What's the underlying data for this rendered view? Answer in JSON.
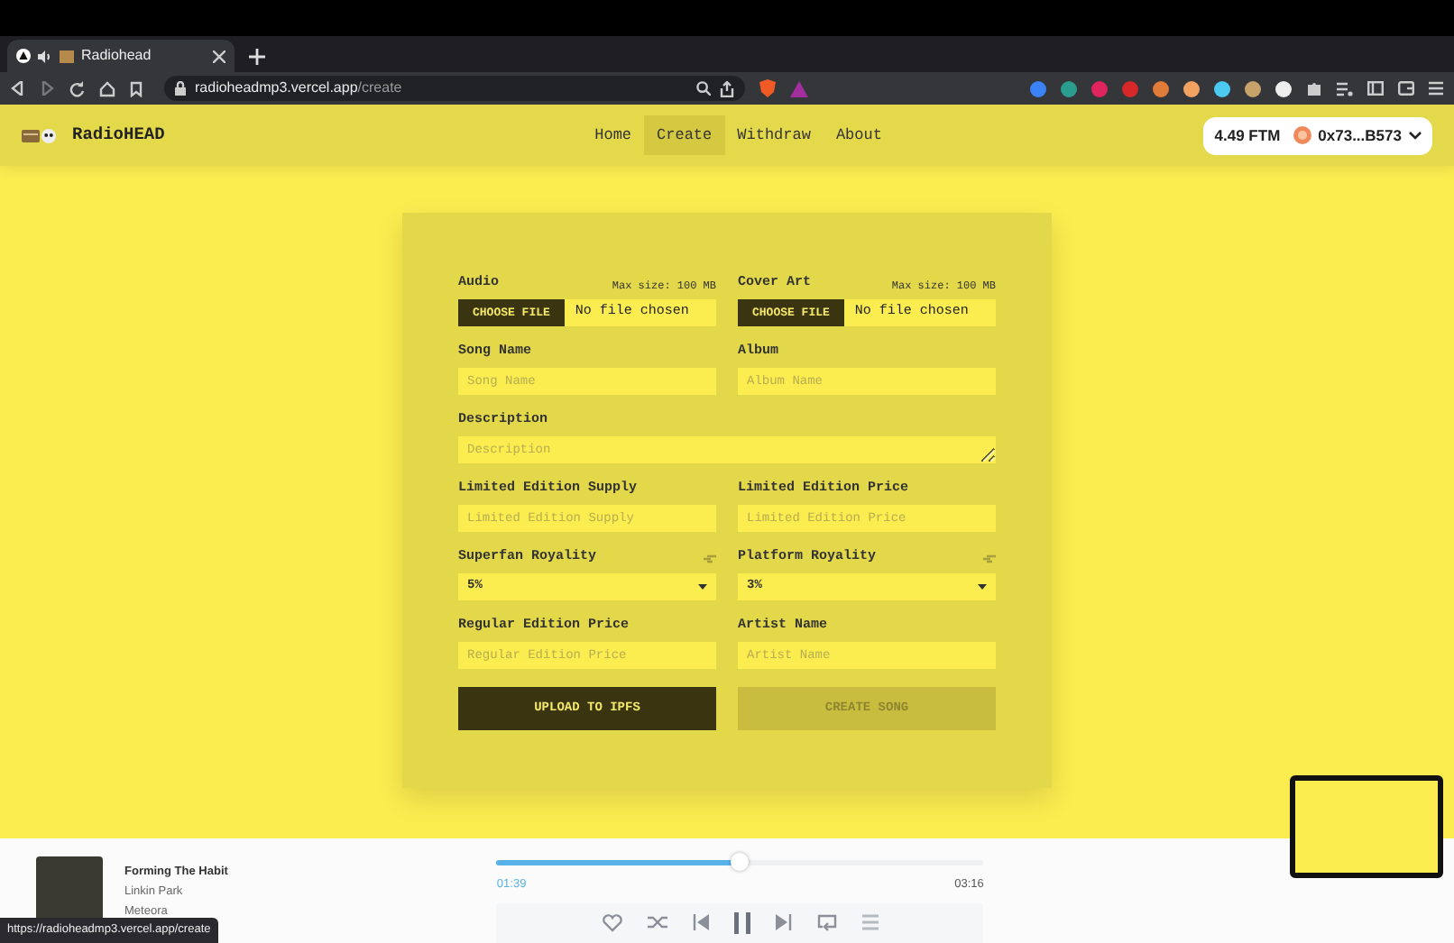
{
  "browser": {
    "tab_title": "Radiohead",
    "url_host": "radioheadmp3.vercel.app",
    "url_path": "/create"
  },
  "navbar": {
    "brand": "RadioHEAD",
    "links": [
      {
        "label": "Home",
        "selected": false
      },
      {
        "label": "Create",
        "selected": true
      },
      {
        "label": "Withdraw",
        "selected": false
      },
      {
        "label": "About",
        "selected": false
      }
    ],
    "balance": "4.49 FTM",
    "account": "0x73...B573"
  },
  "form": {
    "fields": [
      {
        "kind": "file",
        "label": "Audio",
        "note": "Max size: 100 MB",
        "button": "CHOOSE FILE",
        "status": "No file chosen"
      },
      {
        "kind": "file",
        "label": "Cover Art",
        "note": "Max size: 100 MB",
        "button": "CHOOSE FILE",
        "status": "No file chosen"
      },
      {
        "kind": "text",
        "label": "Song Name",
        "placeholder": "Song Name"
      },
      {
        "kind": "text",
        "label": "Album",
        "placeholder": "Album Name"
      },
      {
        "kind": "textarea",
        "label": "Description",
        "placeholder": "Description"
      },
      {
        "kind": "text",
        "label": "Limited Edition Supply",
        "placeholder": "Limited Edition Supply"
      },
      {
        "kind": "text",
        "label": "Limited Edition Price",
        "placeholder": "Limited Edition Price"
      },
      {
        "kind": "select",
        "label": "Superfan Royality",
        "value": "5%"
      },
      {
        "kind": "select",
        "label": "Platform Royality",
        "value": "3%"
      },
      {
        "kind": "text",
        "label": "Regular Edition Price",
        "placeholder": "Regular Edition Price"
      },
      {
        "kind": "text",
        "label": "Artist Name",
        "placeholder": "Artist Name"
      }
    ],
    "buttons": [
      {
        "label": "UPLOAD TO IPFS",
        "disabled": false
      },
      {
        "label": "CREATE SONG",
        "disabled": true
      }
    ]
  },
  "player": {
    "title": "Forming The Habit",
    "artist": "Linkin Park",
    "album": "Meteora",
    "elapsed": "01:39",
    "duration": "03:16",
    "level": 0.5
  },
  "status_url": "https://radioheadmp3.vercel.app/create"
}
